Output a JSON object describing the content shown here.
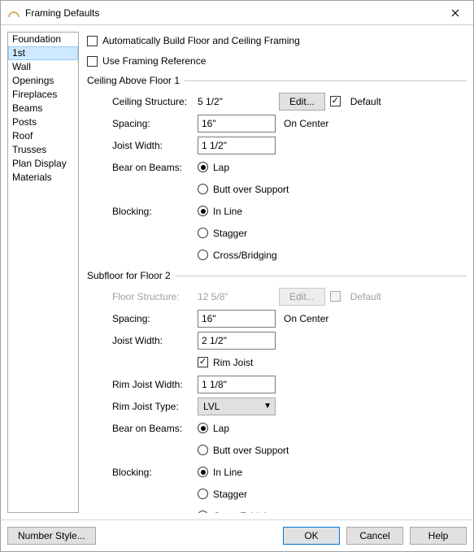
{
  "window": {
    "title": "Framing Defaults"
  },
  "sidebar": {
    "items": [
      {
        "label": "Foundation"
      },
      {
        "label": "1st"
      },
      {
        "label": "Wall"
      },
      {
        "label": "Openings"
      },
      {
        "label": "Fireplaces"
      },
      {
        "label": "Beams"
      },
      {
        "label": "Posts"
      },
      {
        "label": "Roof"
      },
      {
        "label": "Trusses"
      },
      {
        "label": "Plan Display"
      },
      {
        "label": "Materials"
      }
    ],
    "selected_index": 1
  },
  "top_options": {
    "auto_build_label": "Automatically Build Floor and Ceiling Framing",
    "use_ref_label": "Use Framing Reference"
  },
  "ceiling": {
    "group_title": "Ceiling Above Floor 1",
    "structure_label": "Ceiling Structure:",
    "structure_value": "5 1/2\"",
    "edit_label": "Edit...",
    "default_label": "Default",
    "spacing_label": "Spacing:",
    "spacing_value": "16\"",
    "spacing_unit": "On Center",
    "joist_width_label": "Joist Width:",
    "joist_width_value": "1 1/2\"",
    "bear_label": "Bear on Beams:",
    "bear_options": {
      "lap": "Lap",
      "butt": "Butt over Support"
    },
    "blocking_label": "Blocking:",
    "blocking_options": {
      "inline": "In Line",
      "stagger": "Stagger",
      "cross": "Cross/Bridging"
    }
  },
  "subfloor": {
    "group_title": "Subfloor for Floor 2",
    "structure_label": "Floor Structure:",
    "structure_value": "12 5/8\"",
    "edit_label": "Edit...",
    "default_label": "Default",
    "spacing_label": "Spacing:",
    "spacing_value": "16\"",
    "spacing_unit": "On Center",
    "joist_width_label": "Joist Width:",
    "joist_width_value": "2 1/2\"",
    "rim_joist_label": "Rim Joist",
    "rim_width_label": "Rim Joist Width:",
    "rim_width_value": "1 1/8\"",
    "rim_type_label": "Rim Joist Type:",
    "rim_type_value": "LVL",
    "bear_label": "Bear on Beams:",
    "bear_options": {
      "lap": "Lap",
      "butt": "Butt over Support"
    },
    "blocking_label": "Blocking:",
    "blocking_options": {
      "inline": "In Line",
      "stagger": "Stagger",
      "cross": "Cross/Bridging"
    }
  },
  "footer": {
    "number_style": "Number Style...",
    "ok": "OK",
    "cancel": "Cancel",
    "help": "Help"
  }
}
